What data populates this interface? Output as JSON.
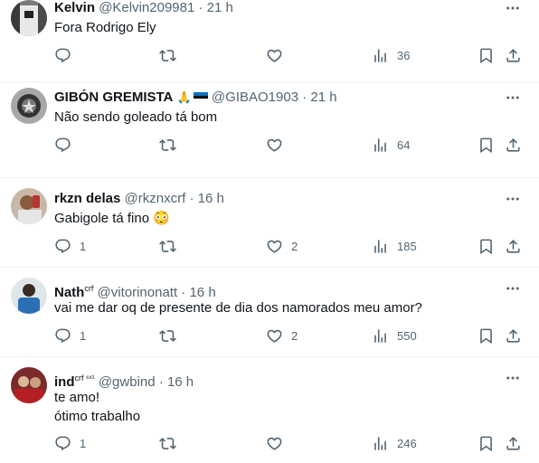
{
  "tweets": [
    {
      "name": "Kelvin",
      "name_sup": "",
      "handle": "@Kelvin209981",
      "time": "21 h",
      "text": "Fora Rodrigo Ely",
      "replies": "",
      "retweets": "",
      "likes": "",
      "views": "36"
    },
    {
      "name": "GIBÓN GREMISTA",
      "name_sup": "",
      "handle": "@GIBAO1903",
      "time": "21 h",
      "text": "Não sendo goleado tá bom",
      "replies": "",
      "retweets": "",
      "likes": "",
      "views": "64"
    },
    {
      "name": "rkzn delas",
      "name_sup": "",
      "handle": "@rkznxcrf",
      "time": "16 h",
      "text": "Gabigole tá fino 😳",
      "replies": "1",
      "retweets": "",
      "likes": "2",
      "views": "185"
    },
    {
      "name": "Nath",
      "name_sup": "crf",
      "handle": "@vitorinonatt",
      "time": "16 h",
      "text": "vai me dar oq de presente de dia dos namorados meu amor?",
      "replies": "1",
      "retweets": "",
      "likes": "2",
      "views": "550"
    },
    {
      "name": "ind",
      "name_sup": "crf ⁶ˣ¹",
      "handle": "@gwbind",
      "time": "16 h",
      "text": "te amo!\nótimo trabalho",
      "replies": "1",
      "retweets": "",
      "likes": "",
      "views": "246"
    }
  ],
  "icons": {
    "reply": "reply-icon",
    "retweet": "retweet-icon",
    "like": "heart-icon",
    "views": "views-icon",
    "bookmark": "bookmark-icon",
    "share": "share-icon",
    "more": "more-icon",
    "pray": "praying-hands-emoji",
    "flag": "estonia-flag"
  },
  "colors": {
    "text": "#0f1419",
    "secondary": "#536471",
    "divider": "#eff3f4"
  }
}
